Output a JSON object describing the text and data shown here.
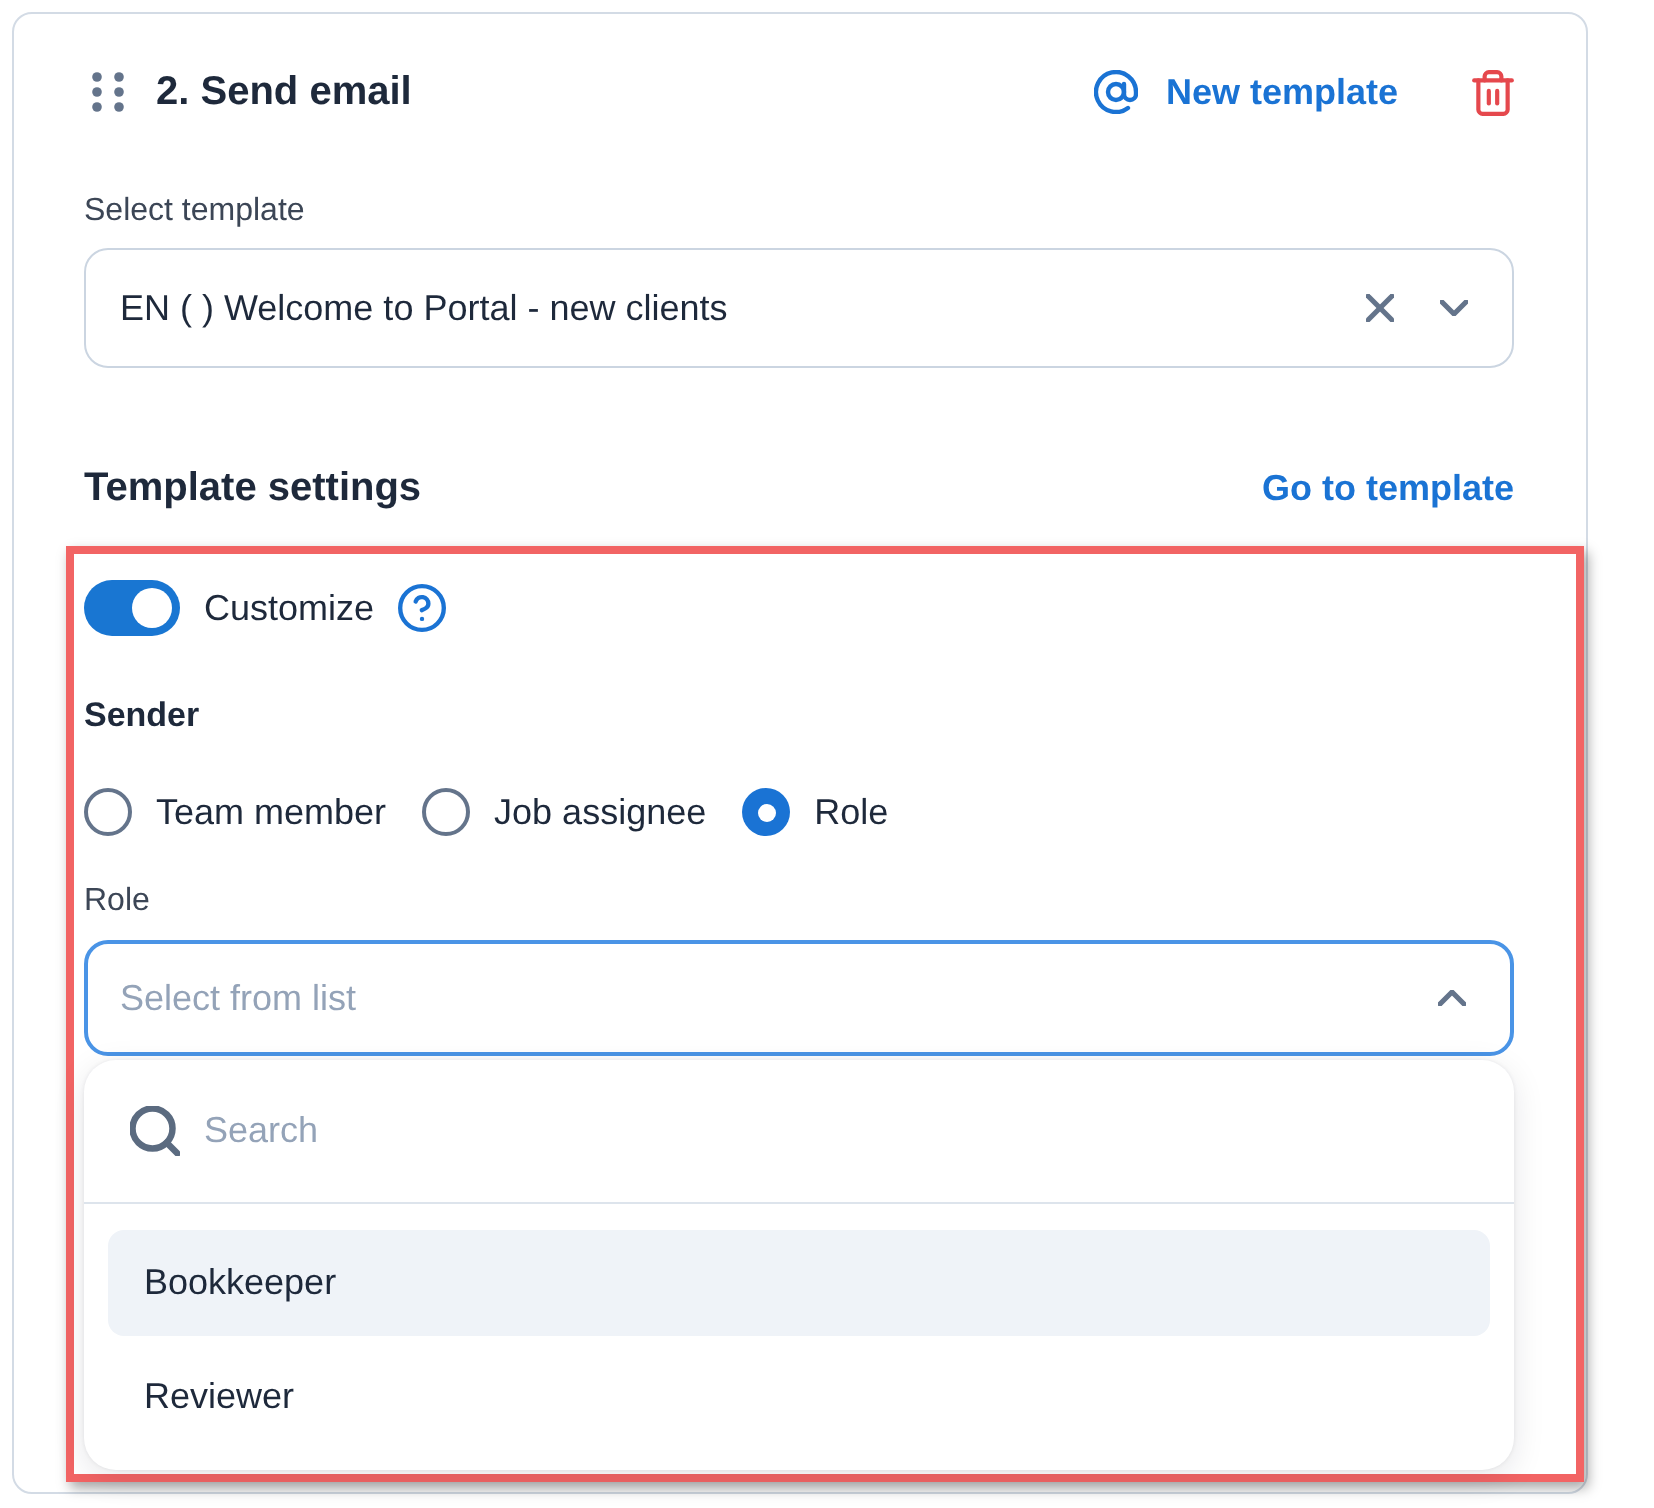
{
  "step": {
    "title": "2. Send email",
    "new_template": "New template"
  },
  "template_select": {
    "label": "Select template",
    "value": "EN ( ) Welcome to Portal - new clients"
  },
  "template_settings": {
    "title": "Template settings",
    "link": "Go to template",
    "highlighted": true
  },
  "customize": {
    "label": "Customize",
    "on": true
  },
  "sender": {
    "title": "Sender",
    "options": [
      {
        "label": "Team member",
        "selected": false
      },
      {
        "label": "Job assignee",
        "selected": false
      },
      {
        "label": "Role",
        "selected": true
      }
    ]
  },
  "role_select": {
    "label": "Role",
    "placeholder": "Select from list",
    "expanded": true
  },
  "dropdown": {
    "search_placeholder": "Search",
    "items": [
      {
        "label": "Bookkeeper",
        "highlighted": true
      },
      {
        "label": "Reviewer",
        "highlighted": false
      }
    ]
  }
}
